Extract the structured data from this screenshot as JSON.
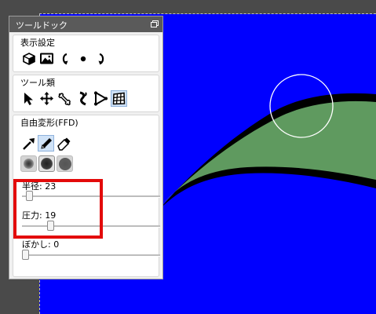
{
  "dock": {
    "title": "ツールドック"
  },
  "display_settings": {
    "title": "表示設定",
    "tools": [
      "cube-icon",
      "image-icon",
      "rotate-left-icon",
      "dot-icon",
      "rotate-right-icon"
    ]
  },
  "tool_types": {
    "title": "ツール類",
    "tools": [
      "select-arrow-icon",
      "move-icon",
      "bone-icon",
      "warp-icon",
      "control-point-icon",
      "ffd-grid-icon"
    ],
    "active": "ffd-grid-icon"
  },
  "ffd": {
    "title": "自由変形(FFD)",
    "modes": [
      "arrow-brush-icon",
      "pen-icon",
      "eraser-icon"
    ],
    "active_mode": "pen-icon",
    "brush_shapes": [
      "soft-brush-icon",
      "medium-brush-icon",
      "hard-brush-icon"
    ],
    "active_brush": "medium-brush-icon",
    "sliders": [
      {
        "label": "半径:  23",
        "value_fraction": 0.03
      },
      {
        "label": "圧力:  19",
        "value_fraction": 0.19
      },
      {
        "label": "ぼかし:  0",
        "value_fraction": 0.0
      }
    ]
  },
  "colors": {
    "canvas": "#0000ff",
    "shape_fill": "#5f9a5f",
    "outline": "#000000",
    "highlight": "#e30a0a",
    "brush_cursor": "#ffffff"
  }
}
